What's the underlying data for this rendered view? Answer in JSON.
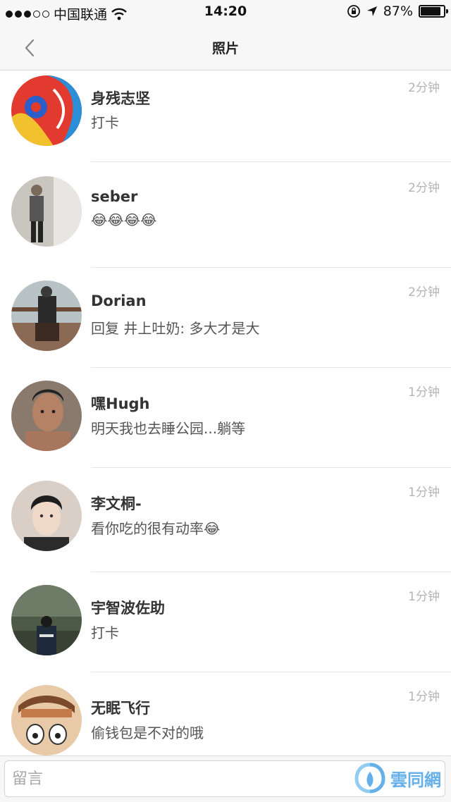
{
  "status_bar": {
    "carrier": "中国联通",
    "time": "14:20",
    "battery": "87%",
    "battery_level": 0.87
  },
  "nav": {
    "title": "照片"
  },
  "comments": [
    {
      "username": "身残志坚",
      "message": "打卡",
      "time": "2分钟"
    },
    {
      "username": "seber",
      "message": "😂😂😂😂",
      "time": "2分钟"
    },
    {
      "username": "Dorian",
      "message": "回复 井上吐奶: 多大才是大",
      "time": "2分钟"
    },
    {
      "username": "嘿Hugh",
      "message": "明天我也去睡公园...躺等",
      "time": "1分钟"
    },
    {
      "username": "李文桐-",
      "message": "看你吃的很有动率😂",
      "time": "1分钟"
    },
    {
      "username": "宇智波佐助",
      "message": "打卡",
      "time": "1分钟"
    },
    {
      "username": "无眠飞行",
      "message": "偷钱包是不对的哦",
      "time": "1分钟"
    }
  ],
  "input": {
    "placeholder": "留言"
  },
  "watermark": {
    "text": "雲同網"
  },
  "colors": {
    "bar_background": "#f7f7f7",
    "time_text": "#b4b4b4",
    "watermark": "#4aa3e6"
  }
}
